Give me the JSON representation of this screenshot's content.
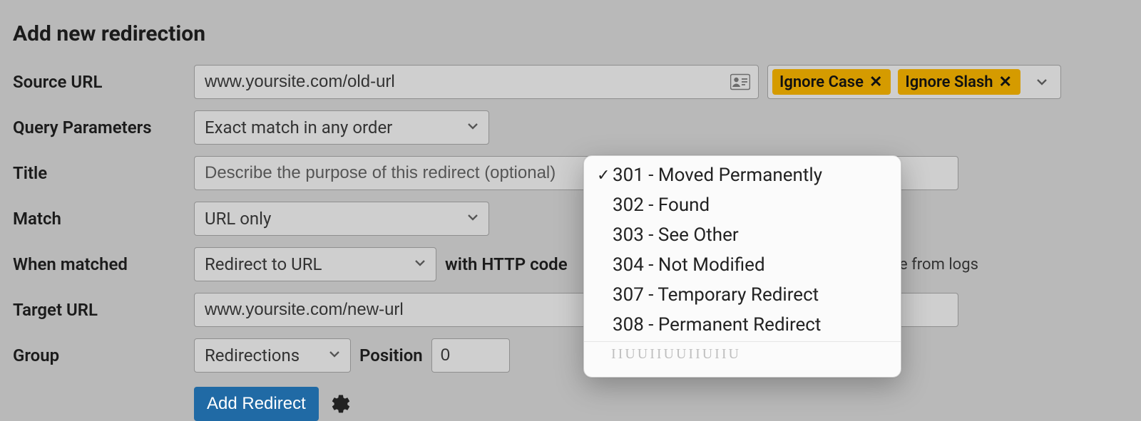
{
  "page": {
    "title": "Add new redirection"
  },
  "labels": {
    "source_url": "Source URL",
    "query_params": "Query Parameters",
    "title": "Title",
    "match": "Match",
    "when_matched": "When matched",
    "with_code": "with HTTP code",
    "target_url": "Target URL",
    "group": "Group",
    "position": "Position",
    "exclude": "clude from logs"
  },
  "source": {
    "value": "www.yoursite.com/old-url",
    "chips": [
      "Ignore Case",
      "Ignore Slash"
    ]
  },
  "query_params": {
    "value": "Exact match in any order"
  },
  "title_field": {
    "placeholder": "Describe the purpose of this redirect (optional)"
  },
  "match": {
    "value": "URL only"
  },
  "when_matched": {
    "value": "Redirect to URL"
  },
  "target": {
    "value": "www.yoursite.com/new-url"
  },
  "group": {
    "value": "Redirections"
  },
  "position": {
    "value": "0"
  },
  "buttons": {
    "add": "Add Redirect"
  },
  "http_codes": {
    "selected_index": 0,
    "options": [
      "301 - Moved Permanently",
      "302 - Found",
      "303 - See Other",
      "304 - Not Modified",
      "307 - Temporary Redirect",
      "308 - Permanent Redirect"
    ]
  },
  "popup_footer_decorative": "IIUUIIUUIIUIIU"
}
